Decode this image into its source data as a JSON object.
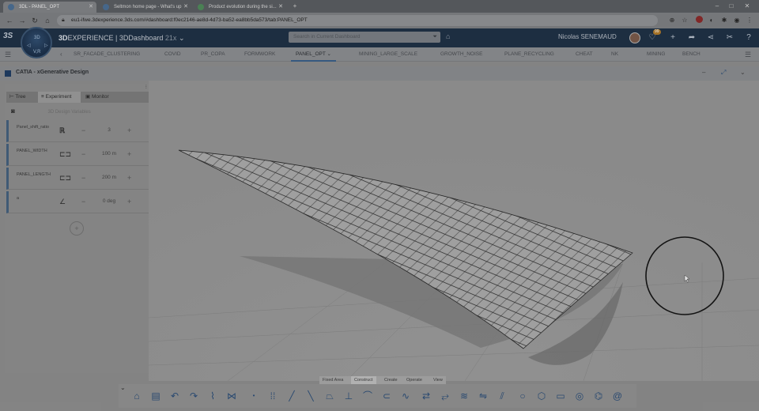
{
  "browser": {
    "tabs": [
      {
        "label": "3DL - PANEL_OPT",
        "active": true
      },
      {
        "label": "Seltmon home page - What's up",
        "active": false
      },
      {
        "label": "Product evolution during the si...",
        "active": false
      }
    ],
    "new_tab": "+",
    "url": "eu1-ifwe.3dexperience.3ds.com/#dashboard:f0ec2146-ae8d-4d73-ba52-ea8bb5da573/tab:PANEL_OPT",
    "window_controls": [
      "–",
      "□",
      "✕"
    ]
  },
  "topbar": {
    "brand_bold": "3D",
    "brand_rest": "EXPERIENCE | 3DDashboard",
    "brand_version": "21x",
    "search_placeholder": "Search in Current Dashboard",
    "username": "Nicolas SENEMAUD",
    "notification_count": "99"
  },
  "compass": {
    "top": "3D",
    "mid": "V.R",
    "bottom": "V,R"
  },
  "dashboard_tabs": [
    "SR_FACADE_CLUSTERING",
    "COVID",
    "PR_COPA",
    "FORMWORK",
    "PANEL_OPT",
    "MINING_LARGE_SCALE",
    "GROWTH_NOISE",
    "PLANE_RECYCLING",
    "CHEAT",
    "NK",
    "MINING",
    "BENCH"
  ],
  "active_dashboard_tab": "PANEL_OPT",
  "app": {
    "title": "CATIA - xGenerative Design"
  },
  "panel": {
    "tabs": [
      "Tree",
      "Experiment",
      "Monitor"
    ],
    "selected_tab": "Experiment",
    "scene_label": "3D Design Variables",
    "parameters": [
      {
        "label": "Panel_shift_ratio",
        "value": "3"
      },
      {
        "label": "PANEL_WIDTH",
        "value": "100 m"
      },
      {
        "label": "PANEL_LENGTH",
        "value": "200 m"
      },
      {
        "label": "a",
        "value": "0 deg"
      }
    ],
    "add_label": "+"
  },
  "bottom_tabs": [
    "Fixed Area",
    "Construct",
    "Create",
    "Operate",
    "View"
  ],
  "active_bottom_tab": "Construct",
  "toolbar_icons": [
    "home-icon",
    "save-icon",
    "undo-icon",
    "redo-icon",
    "feed-icon",
    "graph-icon",
    "point-icon",
    "grid-icon",
    "line-icon",
    "spline-icon",
    "plane-icon",
    "axis-icon",
    "curve-icon",
    "arc-icon",
    "wave-icon",
    "bend-icon",
    "twist-icon",
    "swirl-icon",
    "pipe-icon",
    "multi-curve-icon",
    "circle-icon",
    "hexagon-icon",
    "rectangle-icon",
    "spiral-icon",
    "coil-icon",
    "helix-icon"
  ],
  "colors": {
    "topbar": "#1f3146",
    "accent": "#45607d",
    "toolbar_icon": "#2c4e78"
  }
}
